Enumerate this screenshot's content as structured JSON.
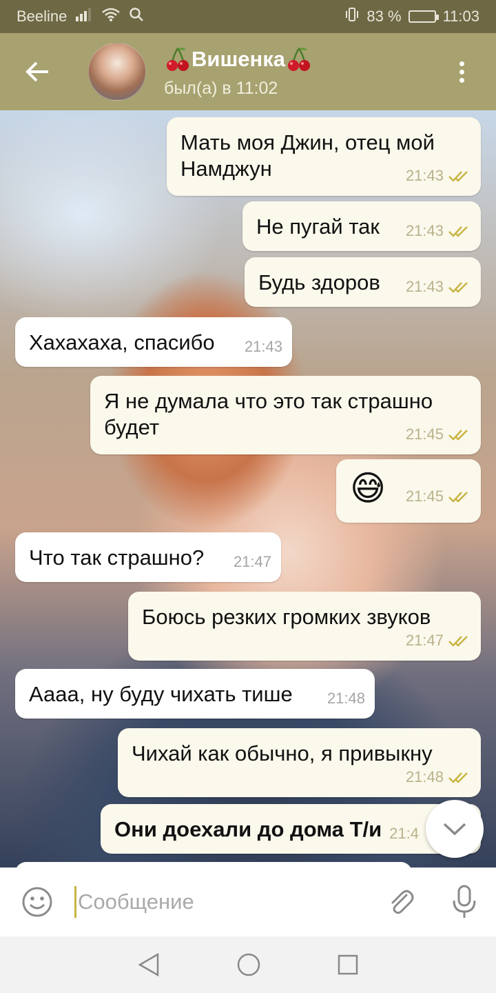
{
  "status_bar": {
    "carrier": "Beeline",
    "battery_percent": "83 %",
    "battery_level": 0.83,
    "time": "11:03",
    "icons": [
      "signal-icon",
      "wifi-icon",
      "search-icon",
      "vibrate-icon",
      "battery-icon"
    ]
  },
  "header": {
    "back_icon": "arrow-left-icon",
    "title": "Вишенка",
    "title_emoji": "cherry-icon",
    "status": "был(а) в 11:02",
    "menu_icon": "more-vertical-icon"
  },
  "messages": [
    {
      "dir": "out",
      "text": "Мать моя Джин, отец мой Намджун",
      "time": "21:43",
      "read": true
    },
    {
      "dir": "out",
      "text": "Не пугай так",
      "time": "21:43",
      "read": true
    },
    {
      "dir": "out",
      "text": "Будь здоров",
      "time": "21:43",
      "read": true
    },
    {
      "dir": "in",
      "text": "Хахахаха, спасибо",
      "time": "21:43"
    },
    {
      "dir": "out",
      "text": "Я не думала что это так страшно будет",
      "time": "21:45",
      "read": true
    },
    {
      "dir": "out",
      "text": "😅",
      "time": "21:45",
      "read": true
    },
    {
      "dir": "in",
      "text": "Что так страшно?",
      "time": "21:47"
    },
    {
      "dir": "out",
      "text": "Боюсь резких громких звуков",
      "time": "21:47",
      "read": true
    },
    {
      "dir": "in",
      "text": "Аааа, ну буду чихать тише",
      "time": "21:48"
    },
    {
      "dir": "out",
      "text": "Чихай как обычно, я привыкну",
      "time": "21:48",
      "read": true
    },
    {
      "dir": "out",
      "text": "Они доехали до дома Т/и",
      "time": "21:4",
      "bold": true
    }
  ],
  "composer": {
    "placeholder": "Сообщение",
    "emoji_icon": "smile-icon",
    "attach_icon": "paperclip-icon",
    "mic_icon": "microphone-icon"
  },
  "scroll_button_icon": "chevron-down-icon",
  "nav": [
    "back-triangle-icon",
    "home-circle-icon",
    "recents-square-icon"
  ],
  "colors": {
    "status_bar": "#6e6845",
    "header": "#a7a270",
    "outgoing_bubble": "#fbf8ec",
    "incoming_bubble": "#ffffff",
    "check_color": "#c9b440"
  }
}
